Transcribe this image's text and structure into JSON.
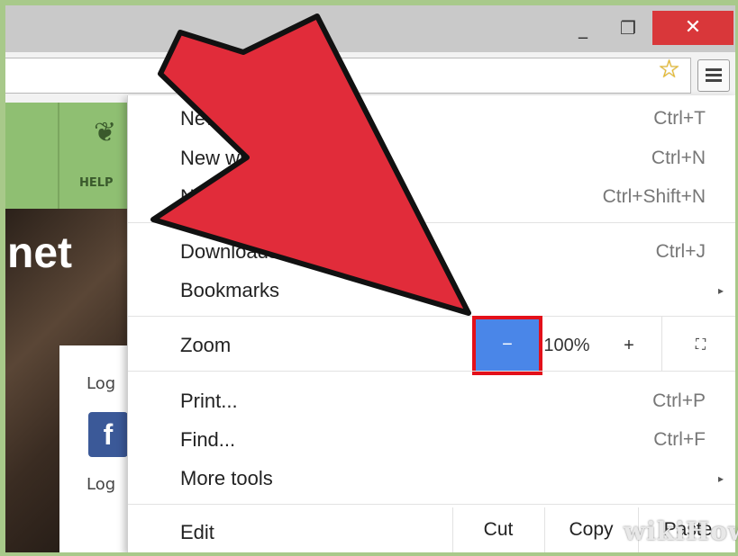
{
  "window": {
    "minimize_icon": "minimize-icon",
    "maximize_icon": "restore-icon",
    "close_icon": "close-icon",
    "minimize_glyph": "_",
    "maximize_glyph": "❐",
    "close_glyph": "✕"
  },
  "toolbar": {
    "star_icon": "bookmark-star-icon",
    "star_glyph": "☆",
    "menu_icon": "hamburger-menu-icon"
  },
  "page": {
    "nav_help_label": "HELP",
    "hero_text": "net",
    "login_label_1": "Log",
    "login_label_2": "Log",
    "facebook_glyph": "f"
  },
  "menu": {
    "items": [
      {
        "label": "New tab",
        "shortcut": "Ctrl+T"
      },
      {
        "label": "New window",
        "shortcut": "Ctrl+N"
      },
      {
        "label": "New incognito window",
        "shortcut": "Ctrl+Shift+N"
      },
      {
        "label": "Downloads",
        "shortcut": "Ctrl+J"
      },
      {
        "label": "Bookmarks",
        "submenu": "▸"
      },
      {
        "label": "Print...",
        "shortcut": "Ctrl+P"
      },
      {
        "label": "Find...",
        "shortcut": "Ctrl+F"
      },
      {
        "label": "More tools",
        "submenu": "▸"
      }
    ],
    "zoom": {
      "label": "Zoom",
      "minus": "−",
      "value": "100%",
      "plus": "+",
      "fullscreen": "⛶"
    },
    "edit": {
      "label": "Edit",
      "cut": "Cut",
      "copy": "Copy",
      "paste": "Paste"
    }
  },
  "watermark": "wikiHow",
  "colors": {
    "accent_highlight": "#e3101a",
    "zoom_minus_bg": "#4a86e8",
    "arrow_fill": "#e12c3a",
    "close_button": "#d9373a",
    "site_green": "#8fbf72"
  }
}
